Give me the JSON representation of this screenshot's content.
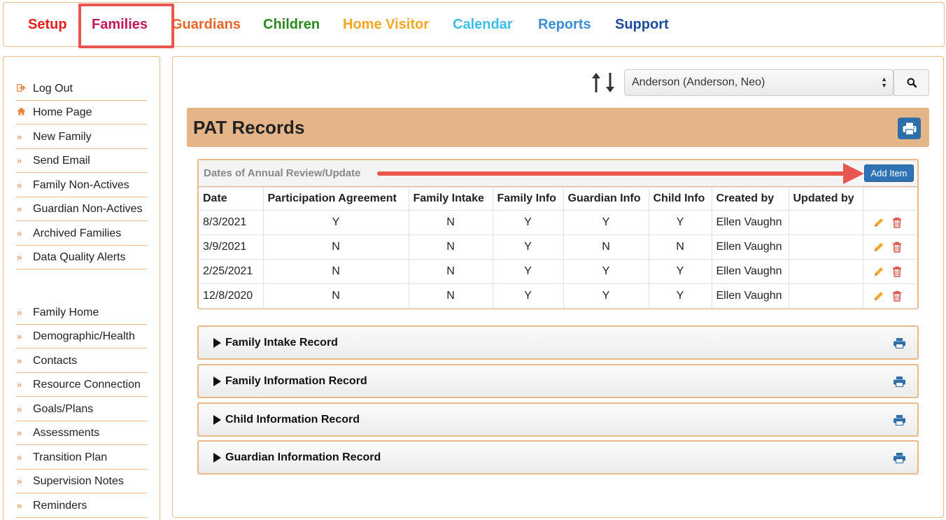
{
  "topnav": [
    {
      "label": "Setup",
      "color": "#e02020"
    },
    {
      "label": "Families",
      "color": "#c0185a"
    },
    {
      "label": "Guardians",
      "color": "#e8672a"
    },
    {
      "label": "Children",
      "color": "#2a8a1e"
    },
    {
      "label": "Home Visitor",
      "color": "#f5a623"
    },
    {
      "label": "Calendar",
      "color": "#3dbde8"
    },
    {
      "label": "Reports",
      "color": "#3a8fd8"
    },
    {
      "label": "Support",
      "color": "#1c4a9c"
    }
  ],
  "sidebar": {
    "group1": [
      {
        "label": "Log Out",
        "icon": "sign-out-icon"
      },
      {
        "label": "Home Page",
        "icon": "home-icon"
      },
      {
        "label": "New Family",
        "icon": "chevron-double-right-icon"
      },
      {
        "label": "Send Email",
        "icon": "chevron-double-right-icon"
      },
      {
        "label": "Family Non-Actives",
        "icon": "chevron-double-right-icon"
      },
      {
        "label": "Guardian Non-Actives",
        "icon": "chevron-double-right-icon"
      },
      {
        "label": "Archived Families",
        "icon": "chevron-double-right-icon"
      },
      {
        "label": "Data Quality Alerts",
        "icon": "chevron-double-right-icon"
      }
    ],
    "group2": [
      {
        "label": "Family Home"
      },
      {
        "label": "Demographic/Health"
      },
      {
        "label": "Contacts"
      },
      {
        "label": "Resource Connection"
      },
      {
        "label": "Goals/Plans"
      },
      {
        "label": "Assessments"
      },
      {
        "label": "Transition Plan"
      },
      {
        "label": "Supervision Notes"
      },
      {
        "label": "Reminders"
      }
    ]
  },
  "family_select": {
    "value": "Anderson (Anderson, Neo)"
  },
  "page": {
    "title": "PAT Records"
  },
  "review": {
    "title": "Dates of Annual Review/Update",
    "add_label": "Add Item",
    "columns": [
      "Date",
      "Participation Agreement",
      "Family Intake",
      "Family Info",
      "Guardian Info",
      "Child Info",
      "Created by",
      "Updated by",
      ""
    ],
    "rows": [
      [
        "8/3/2021",
        "Y",
        "N",
        "Y",
        "Y",
        "Y",
        "Ellen Vaughn",
        ""
      ],
      [
        "3/9/2021",
        "N",
        "N",
        "Y",
        "N",
        "N",
        "Ellen Vaughn",
        ""
      ],
      [
        "2/25/2021",
        "N",
        "N",
        "Y",
        "Y",
        "Y",
        "Ellen Vaughn",
        ""
      ],
      [
        "12/8/2020",
        "N",
        "N",
        "Y",
        "Y",
        "Y",
        "Ellen Vaughn",
        ""
      ]
    ]
  },
  "sections": [
    {
      "label": "Family Intake Record"
    },
    {
      "label": "Family Information Record"
    },
    {
      "label": "Child Information Record"
    },
    {
      "label": "Guardian Information Record"
    }
  ],
  "colors": {
    "accent": "#e8b88a",
    "banner": "#e5b58a",
    "button": "#2f73b5",
    "annotation": "#e8564f"
  }
}
